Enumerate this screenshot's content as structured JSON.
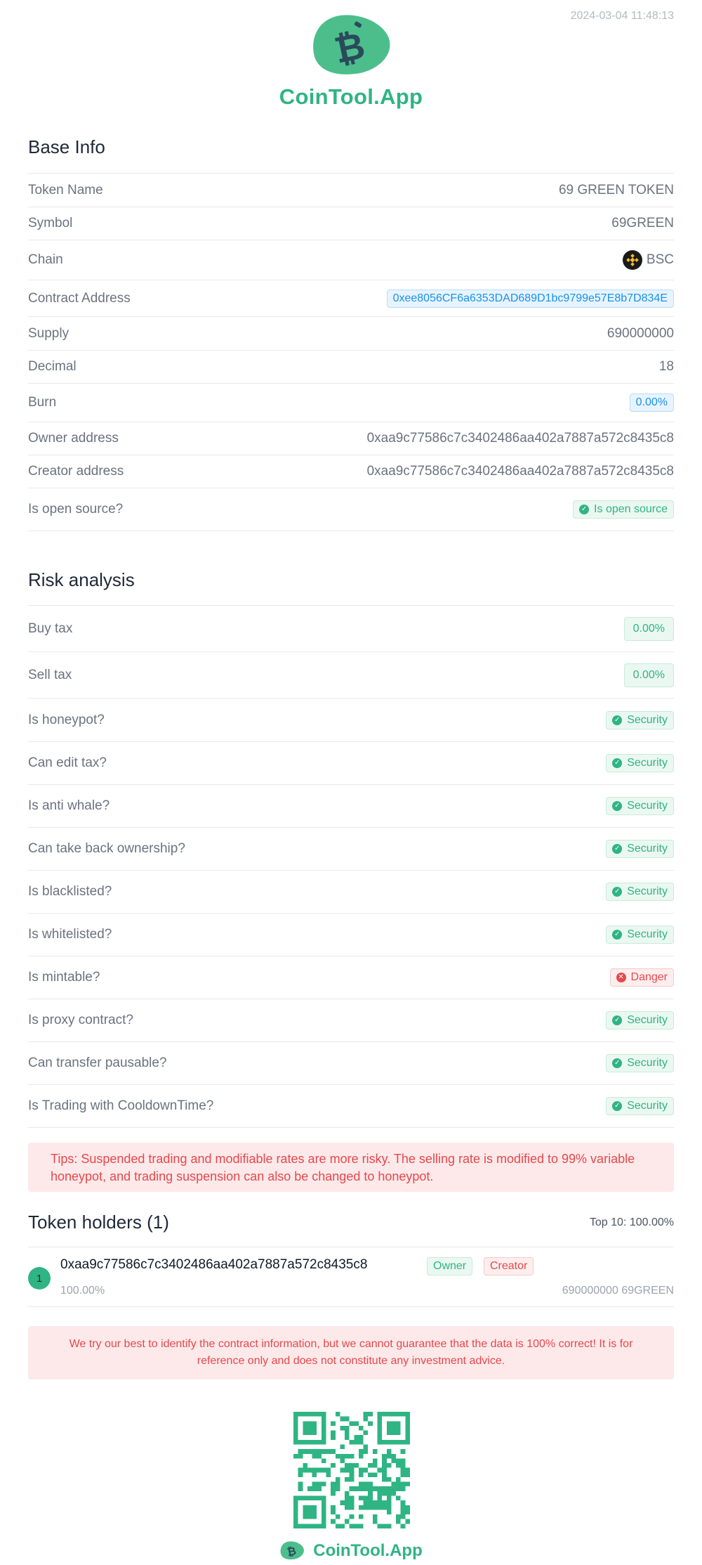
{
  "timestamp": "2024-03-04 11:48:13",
  "brand": {
    "name": "CoinTool.App"
  },
  "base_info": {
    "title": "Base Info",
    "token_name": {
      "label": "Token Name",
      "value": "69 GREEN TOKEN"
    },
    "symbol": {
      "label": "Symbol",
      "value": "69GREEN"
    },
    "chain": {
      "label": "Chain",
      "value": "BSC",
      "icon": "bnb-chain-icon"
    },
    "contract": {
      "label": "Contract Address",
      "value": "0xee8056CF6a6353DAD689D1bc9799e57E8b7D834E"
    },
    "supply": {
      "label": "Supply",
      "value": "690000000"
    },
    "decimal": {
      "label": "Decimal",
      "value": "18"
    },
    "burn": {
      "label": "Burn",
      "value": "0.00%"
    },
    "owner": {
      "label": "Owner address",
      "value": "0xaa9c77586c7c3402486aa402a7887a572c8435c8"
    },
    "creator": {
      "label": "Creator address",
      "value": "0xaa9c77586c7c3402486aa402a7887a572c8435c8"
    },
    "open_source": {
      "label": "Is open source?",
      "value": "Is open source"
    }
  },
  "risk": {
    "title": "Risk analysis",
    "buy_tax": {
      "label": "Buy tax",
      "value": "0.00%"
    },
    "sell_tax": {
      "label": "Sell tax",
      "value": "0.00%"
    },
    "items": [
      {
        "label": "Is honeypot?",
        "status": "Security"
      },
      {
        "label": "Can edit tax?",
        "status": "Security"
      },
      {
        "label": "Is anti whale?",
        "status": "Security"
      },
      {
        "label": "Can take back ownership?",
        "status": "Security"
      },
      {
        "label": "Is blacklisted?",
        "status": "Security"
      },
      {
        "label": "Is whitelisted?",
        "status": "Security"
      },
      {
        "label": "Is mintable?",
        "status": "Danger"
      },
      {
        "label": "Is proxy contract?",
        "status": "Security"
      },
      {
        "label": "Can transfer pausable?",
        "status": "Security"
      },
      {
        "label": "Is Trading with CooldownTime?",
        "status": "Security"
      }
    ]
  },
  "tips": "Tips: Suspended trading and modifiable rates are more risky. The selling rate is modified to 99% variable honeypot, and trading suspension can also be changed to honeypot.",
  "holders": {
    "title": "Token holders (1)",
    "top10": "Top 10: 100.00%",
    "list": [
      {
        "rank": "1",
        "address": "0xaa9c77586c7c3402486aa402a7887a572c8435c8",
        "tag_owner": "Owner",
        "tag_creator": "Creator",
        "percent": "100.00%",
        "amount": "690000000 69GREEN"
      }
    ]
  },
  "disclaimer": "We try our best to identify the contract information, but we cannot guarantee that the data is 100% correct! It is for reference only and does not constitute any investment advice.",
  "colors": {
    "brand_green": "#2fb483",
    "danger_red": "#e6484b",
    "link_blue": "#1991eb"
  }
}
